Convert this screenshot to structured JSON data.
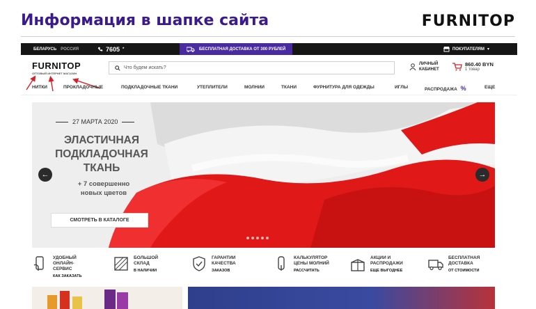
{
  "slide": {
    "title": "Информация в шапке сайта",
    "logo": "FURNITOP"
  },
  "topbar": {
    "region_active": "БЕЛАРУСЬ",
    "region_other": "РОССИЯ",
    "phone": "7605",
    "phone_suffix": "*",
    "promo": "БЕСПЛАТНАЯ ДОСТАВКА ОТ 300 РУБЛЕЙ",
    "buyers": "ПОКУПАТЕЛЯМ"
  },
  "header": {
    "logo": "FURNITOP",
    "logo_sub": "ОПТОВЫЙ ИНТЕРНЕТ МАГАЗИН",
    "search_placeholder": "Что будем искать?",
    "cabinet_line1": "ЛИЧНЫЙ",
    "cabinet_line2": "КАБИНЕТ",
    "cart_sum": "860.40 BYN",
    "cart_count": "1 товар"
  },
  "nav": {
    "items": [
      "НИТКИ",
      "ПРОКЛАДОЧНЫЕ",
      "ПОДКЛАДОЧНЫЕ ТКАНИ",
      "УТЕПЛИТЕЛИ",
      "МОЛНИИ",
      "ТКАНИ",
      "ФУРНИТУРА ДЛЯ ОДЕЖДЫ",
      "ИГЛЫ",
      "РАСПРОДАЖА",
      "ЕЩЕ"
    ]
  },
  "hero": {
    "date": "27 МАРТА 2020",
    "headline_1": "ЭЛАСТИЧНАЯ",
    "headline_2": "ПОДКЛАДОЧНАЯ",
    "headline_3": "ТКАНЬ",
    "sub_1": "+ 7 совершенно",
    "sub_2": "новых цветов",
    "button": "СМОТРЕТЬ В КАТАЛОГЕ",
    "prev": "←",
    "next": "→"
  },
  "features": [
    {
      "l1": "УДОБНЫЙ",
      "l2": "ОНЛАЙН-",
      "l3": "СЕРВИС",
      "link": "КАК ЗАКАЗАТЬ"
    },
    {
      "l1": "БОЛЬШОЙ",
      "l2": "СКЛАД",
      "l3": "",
      "link": "В НАЛИЧИИ"
    },
    {
      "l1": "ГАРАНТИИ",
      "l2": "КАЧЕСТВА",
      "l3": "",
      "link": "ЗАКАЗОВ"
    },
    {
      "l1": "КАЛЬКУЛЯТОР",
      "l2": "ЦЕНЫ МОЛНИЙ",
      "l3": "",
      "link": "РАССЧИТАТЬ"
    },
    {
      "l1": "АКЦИИ И",
      "l2": "РАСПРОДАЖИ",
      "l3": "",
      "link": "ЕЩЕ ВЫГОДНЕЕ"
    },
    {
      "l1": "БЕСПЛАТНАЯ",
      "l2": "ДОСТАВКА",
      "l3": "",
      "link": "ОТ СТОИМОСТИ"
    }
  ],
  "colors": {
    "title": "#3b1b8c",
    "promo": "#4a2aa0",
    "arrow": "#d81f26",
    "nav_sale_icon": "#4a2aa0"
  }
}
